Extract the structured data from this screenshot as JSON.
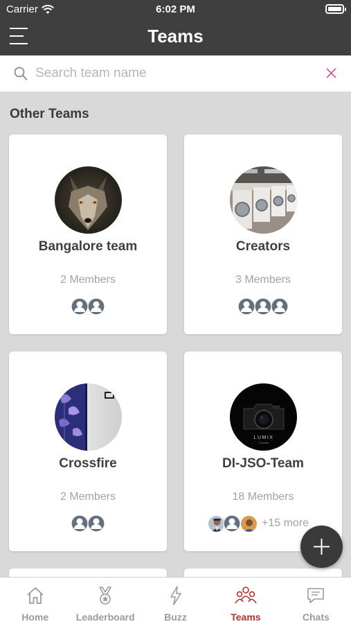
{
  "status_bar": {
    "carrier": "Carrier",
    "time": "6:02 PM"
  },
  "header": {
    "title": "Teams"
  },
  "search": {
    "placeholder": "Search team name",
    "value": ""
  },
  "section_title": "Other Teams",
  "teams": [
    {
      "name": "Bangalore team",
      "members_label": "2 Members"
    },
    {
      "name": "Creators",
      "members_label": "3 Members"
    },
    {
      "name": "Crossfire",
      "members_label": "2 Members"
    },
    {
      "name": "DI-JSO-Team",
      "members_label": "18 Members",
      "more_label": "+15 more"
    }
  ],
  "tabs": [
    {
      "label": "Home",
      "icon": "home-icon"
    },
    {
      "label": "Leaderboard",
      "icon": "trophy-icon"
    },
    {
      "label": "Buzz",
      "icon": "lightning-icon"
    },
    {
      "label": "Teams",
      "icon": "people-icon",
      "active": true
    },
    {
      "label": "Chats",
      "icon": "chat-icon"
    }
  ],
  "colors": {
    "header_bg": "#3f3f3f",
    "page_bg": "#d9d9d9",
    "accent": "#b3322e",
    "clear_icon": "#e0548a"
  }
}
